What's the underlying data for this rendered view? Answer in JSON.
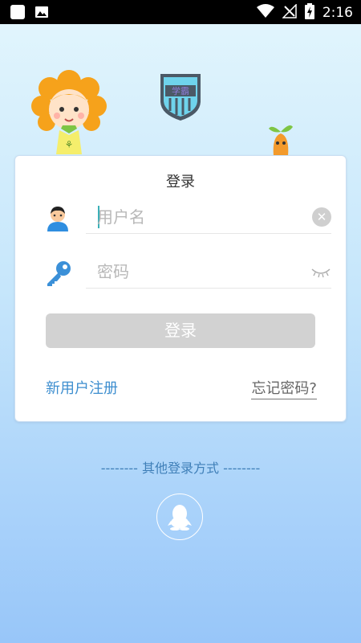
{
  "status_bar": {
    "time": "2:16",
    "icons": [
      "app-notification-icon",
      "image-notification-icon",
      "wifi-icon",
      "no-signal-icon",
      "battery-charging-icon"
    ]
  },
  "branding": {
    "mascot": "flower-mascot",
    "logo": "badge-logo",
    "sprout": "sprout-mascot"
  },
  "login_card": {
    "title": "登录",
    "username": {
      "placeholder": "用户名",
      "value": "",
      "icon": "user-avatar-icon"
    },
    "password": {
      "placeholder": "密码",
      "value": "",
      "icon": "key-icon"
    },
    "login_button": "登录",
    "register_link": "新用户注册",
    "forgot_link": "忘记密码?"
  },
  "other_login": {
    "label": "-------- 其他登录方式 --------",
    "providers": [
      "qq-icon"
    ]
  },
  "colors": {
    "accent": "#3d8ecf",
    "key_icon": "#3b90d8",
    "button_disabled": "#d2d2d2",
    "background_top": "#e3f6fd",
    "background_bottom": "#98c6f9"
  }
}
